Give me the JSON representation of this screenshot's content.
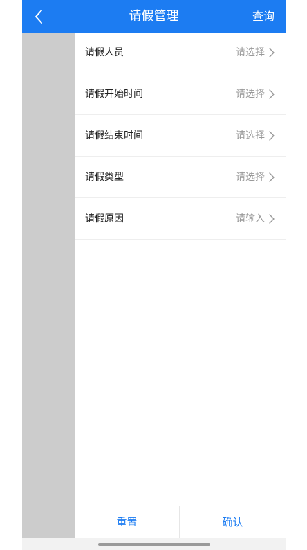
{
  "header": {
    "title": "请假管理",
    "action_label": "查询",
    "back_icon": "chevron-left-icon"
  },
  "form": {
    "rows": [
      {
        "label": "请假人员",
        "placeholder": "请选择"
      },
      {
        "label": "请假开始时间",
        "placeholder": "请选择"
      },
      {
        "label": "请假结束时间",
        "placeholder": "请选择"
      },
      {
        "label": "请假类型",
        "placeholder": "请选择"
      },
      {
        "label": "请假原因",
        "placeholder": "请输入"
      }
    ]
  },
  "footer": {
    "reset_label": "重置",
    "confirm_label": "确认"
  },
  "colors": {
    "accent": "#1c7cf2",
    "sidebar_overlay": "#cccccc",
    "placeholder_text": "#999999",
    "label_text": "#222222"
  }
}
